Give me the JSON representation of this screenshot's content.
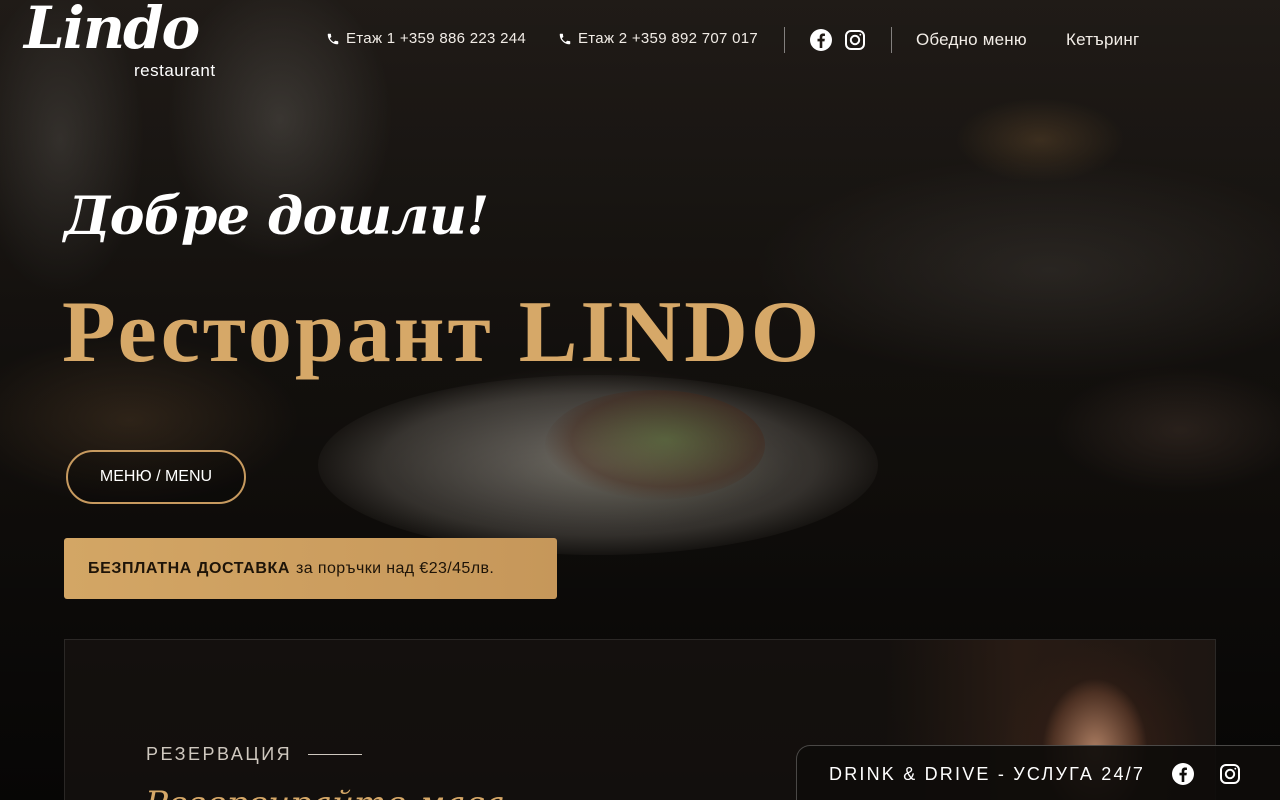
{
  "brand": {
    "logo_script": "Lindo",
    "logo_sub": "restaurant"
  },
  "header": {
    "phone1": "Етаж 1 +359 886 223 244",
    "phone2": "Етаж 2 +359 892 707 017",
    "nav": [
      "Обедно меню",
      "Кетъринг"
    ],
    "social_icons": [
      "facebook-icon",
      "instagram-icon"
    ]
  },
  "hero": {
    "welcome": "Добре дошли!",
    "title": "Ресторант LINDO",
    "menu_button": "МЕНЮ / MENU",
    "delivery_bold": "БЕЗПЛАТНА ДОСТАВКА",
    "delivery_rest": "за поръчки над €23/45лв."
  },
  "reservation": {
    "label": "РЕЗЕРВАЦИЯ",
    "heading": "Резервирайте маса"
  },
  "drink_drive": {
    "text": "DRINK & DRIVE - УСЛУГА 24/7"
  },
  "colors": {
    "accent_gold": "#d6a868",
    "delivery_bg": "#cfa263",
    "button_border": "#c79a5f"
  }
}
